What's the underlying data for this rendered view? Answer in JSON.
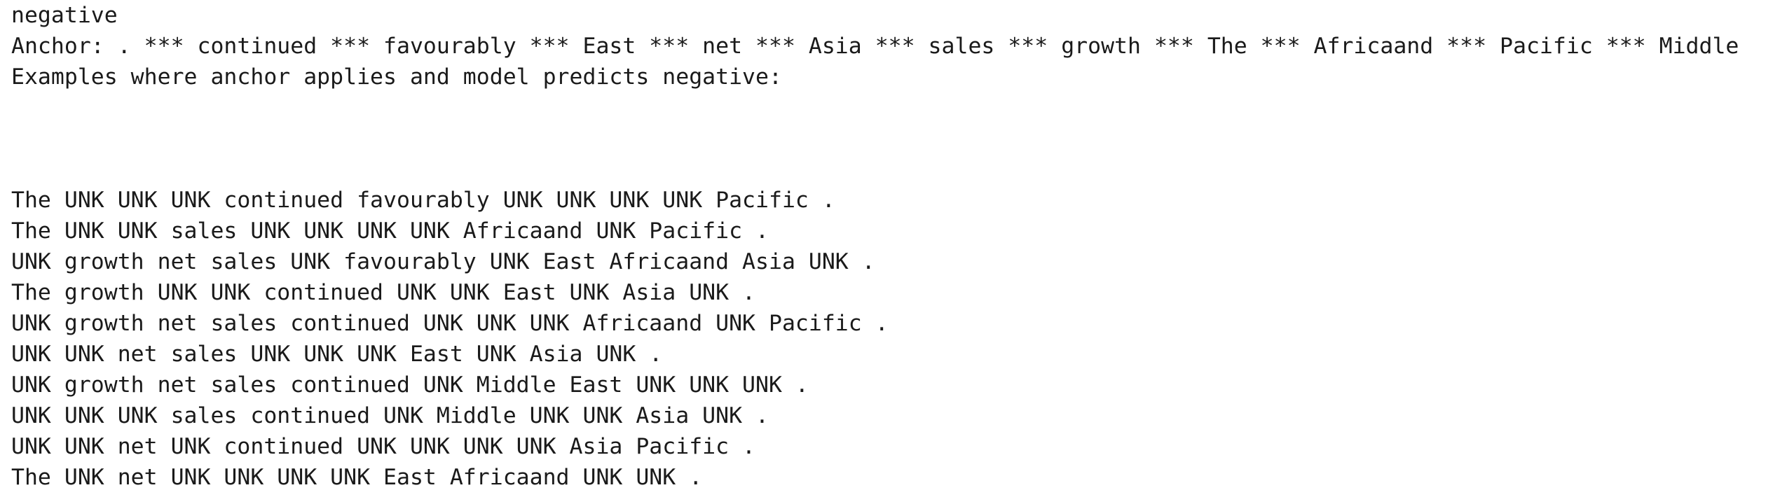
{
  "output": {
    "label": "negative",
    "anchor_line": "Anchor: . *** continued *** favourably *** East *** net *** Asia *** sales *** growth *** The *** Africaand *** Pacific *** Middle",
    "examples_header": "Examples where anchor applies and model predicts negative:",
    "examples": [
      "The UNK UNK UNK continued favourably UNK UNK UNK UNK Pacific .",
      "The UNK UNK sales UNK UNK UNK UNK Africaand UNK Pacific .",
      "UNK growth net sales UNK favourably UNK East Africaand Asia UNK .",
      "The growth UNK UNK continued UNK UNK East UNK Asia UNK .",
      "UNK growth net sales continued UNK UNK UNK Africaand UNK Pacific .",
      "UNK UNK net sales UNK UNK UNK East UNK Asia UNK .",
      "UNK growth net sales continued UNK Middle East UNK UNK UNK .",
      "UNK UNK UNK sales continued UNK Middle UNK UNK Asia UNK .",
      "UNK UNK net UNK continued UNK UNK UNK UNK Asia Pacific .",
      "The UNK net UNK UNK UNK UNK East Africaand UNK UNK ."
    ]
  }
}
